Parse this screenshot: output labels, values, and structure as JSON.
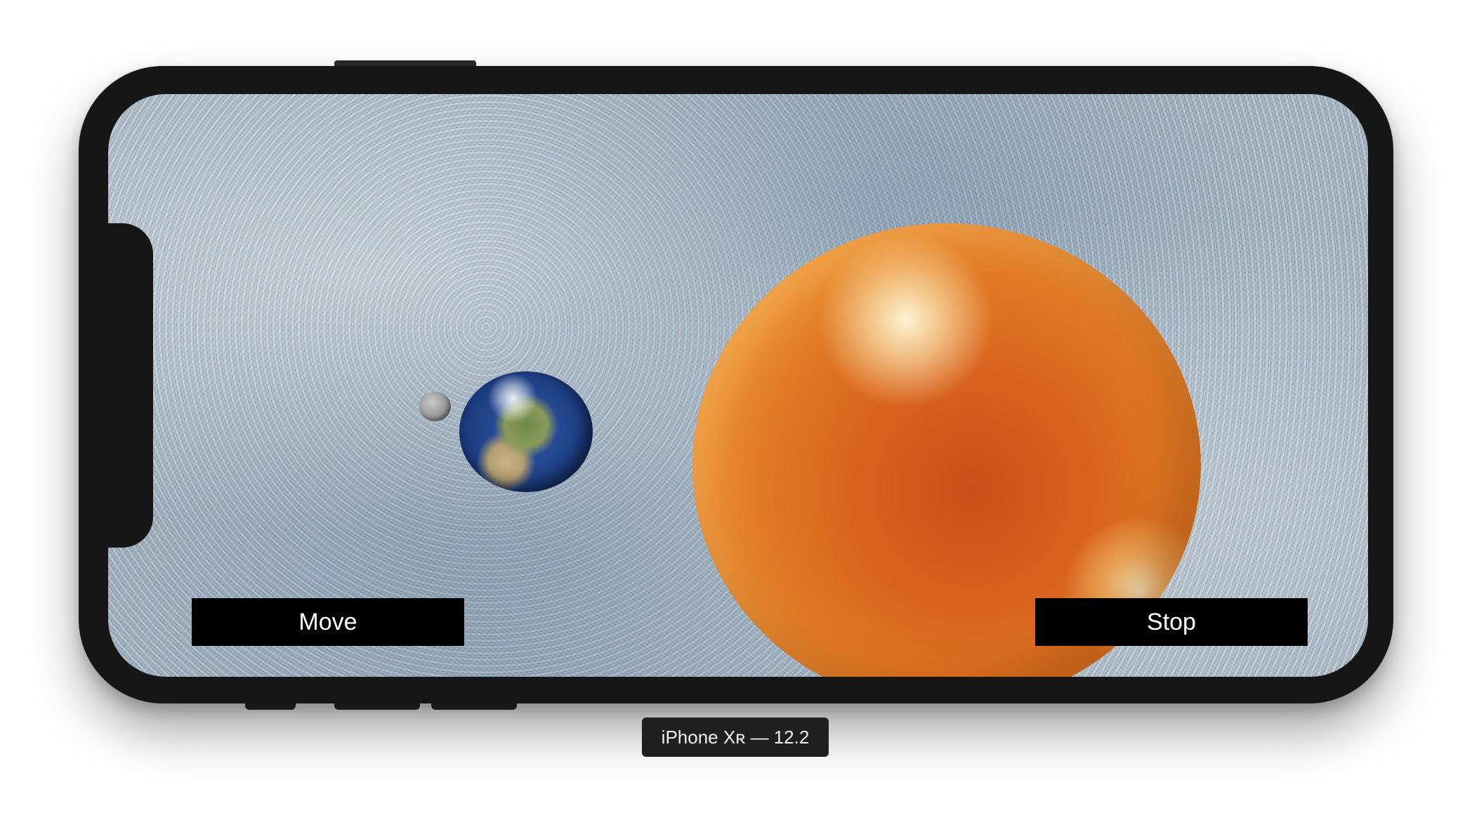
{
  "simulator": {
    "device_label": "iPhone Xʀ — 12.2"
  },
  "app": {
    "buttons": {
      "move_label": "Move",
      "stop_label": "Stop"
    },
    "scene": {
      "objects": [
        "moon",
        "earth",
        "sun"
      ],
      "background": "cloud texture"
    }
  },
  "colors": {
    "device_frame": "#161616",
    "button_bg": "#000000",
    "button_text": "#ffffff",
    "label_bg": "#1f1f1f"
  }
}
